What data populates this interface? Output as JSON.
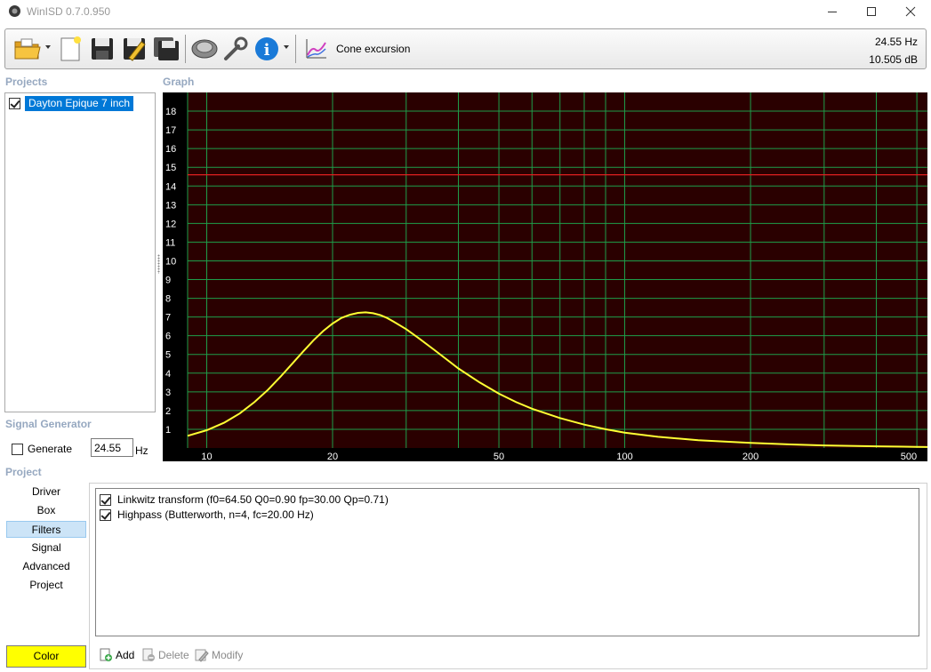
{
  "window": {
    "title": "WinISD 0.7.0.950"
  },
  "toolbar": {
    "mode_label": "Cone excursion",
    "readout_freq": "24.55 Hz",
    "readout_level": "10.505 dB"
  },
  "sections": {
    "projects": "Projects",
    "graph": "Graph",
    "signal_generator": "Signal Generator",
    "project": "Project"
  },
  "projects": [
    {
      "name": "Dayton Epique 7 inch",
      "checked": true
    }
  ],
  "signal_generator": {
    "generate_label": "Generate",
    "frequency": "24.55",
    "unit": "Hz"
  },
  "nav": [
    {
      "label": "Driver",
      "active": false
    },
    {
      "label": "Box",
      "active": false
    },
    {
      "label": "Filters",
      "active": true
    },
    {
      "label": "Signal",
      "active": false
    },
    {
      "label": "Advanced",
      "active": false
    },
    {
      "label": "Project",
      "active": false
    }
  ],
  "color_button": {
    "label": "Color",
    "color": "#ffff00"
  },
  "filters": [
    {
      "text": "Linkwitz transform (f0=64.50 Q0=0.90 fp=30.00 Qp=0.71)",
      "checked": true
    },
    {
      "text": "Highpass (Butterworth, n=4, fc=20.00 Hz)",
      "checked": true
    }
  ],
  "actions": {
    "add": "Add",
    "delete": "Delete",
    "modify": "Modify"
  },
  "colors": {
    "plot_background": "#2a0000",
    "grid": "#1e9e4a",
    "curve": "#ffff33",
    "limit_line": "#e02020",
    "accent": "#0078d7"
  },
  "chart_data": {
    "type": "line",
    "title": "",
    "xlabel": "",
    "ylabel": "",
    "x_scale": "log",
    "xlim": [
      9,
      530
    ],
    "ylim": [
      0,
      19
    ],
    "x_tick_labels": [
      "10",
      "20",
      "50",
      "100",
      "200",
      "500"
    ],
    "x_ticks": [
      10,
      20,
      50,
      100,
      200,
      500
    ],
    "y_ticks": [
      1,
      2,
      3,
      4,
      5,
      6,
      7,
      8,
      9,
      10,
      11,
      12,
      13,
      14,
      15,
      16,
      17,
      18
    ],
    "grid": true,
    "limit_line": 14.6,
    "series": [
      {
        "x": [
          9,
          10,
          11,
          12,
          13,
          14,
          15,
          16,
          17,
          18,
          19,
          20,
          21,
          22,
          23,
          24,
          25,
          26,
          27,
          28,
          30,
          32,
          35,
          40,
          45,
          50,
          55,
          60,
          70,
          80,
          90,
          100,
          120,
          150,
          200,
          250,
          300,
          400,
          500,
          530
        ],
        "y": [
          0.65,
          0.95,
          1.35,
          1.85,
          2.45,
          3.1,
          3.8,
          4.5,
          5.15,
          5.75,
          6.25,
          6.65,
          6.95,
          7.12,
          7.22,
          7.25,
          7.2,
          7.1,
          6.95,
          6.75,
          6.35,
          5.9,
          5.25,
          4.25,
          3.5,
          2.9,
          2.45,
          2.1,
          1.6,
          1.25,
          1.0,
          0.82,
          0.6,
          0.42,
          0.27,
          0.19,
          0.14,
          0.09,
          0.06,
          0.05
        ]
      }
    ]
  }
}
